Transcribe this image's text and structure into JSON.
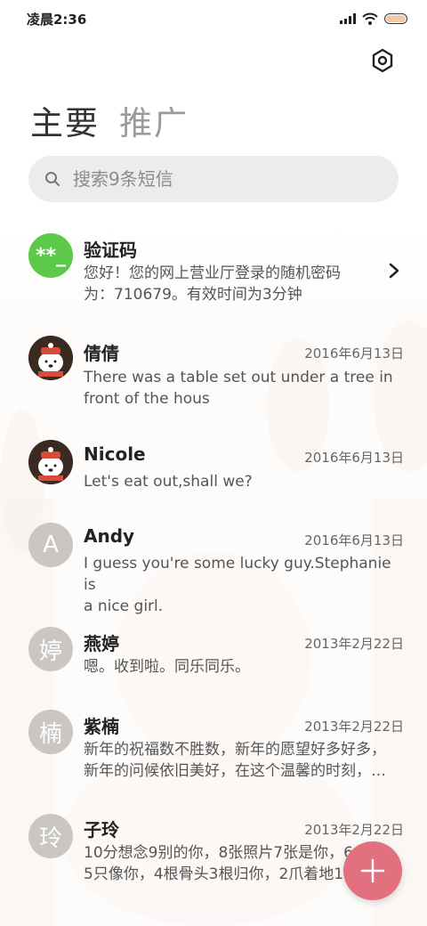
{
  "status_bar": {
    "time": "凌晨2:36"
  },
  "tabs": [
    {
      "label": "主要"
    },
    {
      "label": "推广"
    }
  ],
  "search": {
    "placeholder": "搜索9条短信"
  },
  "colors": {
    "fab": "#e2707e",
    "code_avatar": "#5cc94a",
    "letter_avatar": "#c9c6c3"
  },
  "conversations": [
    {
      "name": "验证码",
      "avatar_text": "**_",
      "date": "",
      "preview": "您好！您的网上营业厅登录的随机密码\n为：710679。有效时间为3分钟"
    },
    {
      "name": "倩倩",
      "avatar_icon": "polar-bear-avatar",
      "date": "2016年6月13日",
      "preview": "There was a table set out under a tree in\nfront of the hous"
    },
    {
      "name": "Nicole",
      "avatar_icon": "polar-bear-avatar",
      "date": "2016年6月13日",
      "preview": "Let's eat out,shall we?"
    },
    {
      "name": "Andy",
      "avatar_text": "A",
      "date": "2016年6月13日",
      "preview": "I guess you're some lucky guy.Stephanie is\na nice girl."
    },
    {
      "name": "燕婷",
      "avatar_text": "婷",
      "date": "2013年2月22日",
      "preview": "嗯。收到啦。同乐同乐。"
    },
    {
      "name": "紫楠",
      "avatar_text": "楠",
      "date": "2013年2月22日",
      "preview": "新年的祝福数不胜数，新年的愿望好多好多，\n新年的问候依旧美好，在这个温馨的时刻，…"
    },
    {
      "name": "子玲",
      "avatar_text": "玲",
      "date": "2013年2月22日",
      "preview": "10分想念9别的你，8张照片7张是你，6\n5只像你，4根骨头3根归你，2爪着地1"
    }
  ]
}
